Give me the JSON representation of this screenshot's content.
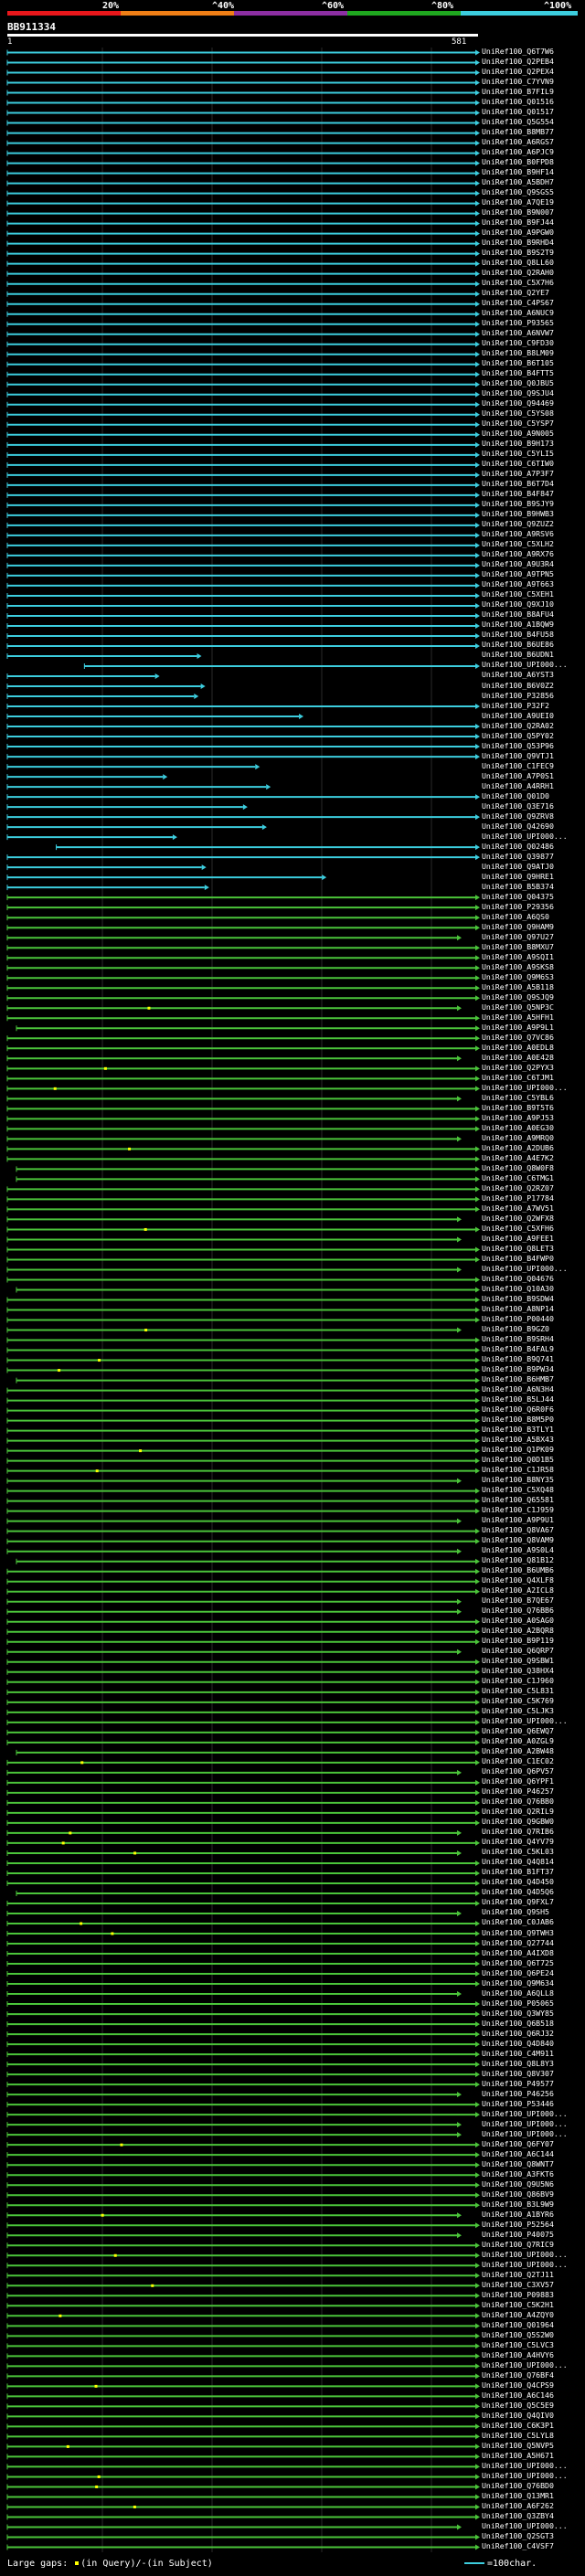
{
  "legend": {
    "percent_labels": [
      "20%",
      "^40%",
      "^60%",
      "^80%",
      "^100%"
    ],
    "colors": [
      "#e8171b",
      "#f07f16",
      "#8d2fa3",
      "#1fa71f",
      "#3ccdde"
    ]
  },
  "header": {
    "query_id": "BB911334",
    "scale_start": "1",
    "scale_end": "581"
  },
  "colors": {
    "cyan_hit": "#3ccdde",
    "green_hit": "#4bc43a",
    "background": "#000000",
    "grid": "#333333",
    "gap_marker": "#ffff00"
  },
  "hits": [
    "UniRef100_Q6T7W6",
    "UniRef100_Q2PEB4",
    "UniRef100_Q2PEX4",
    "UniRef100_C7YVN9",
    "UniRef100_B7FIL9",
    "UniRef100_Q01516",
    "UniRef100_Q01517",
    "UniRef100_Q5G554",
    "UniRef100_B8MB77",
    "UniRef100_A6RGS7",
    "UniRef100_A6PJC9",
    "UniRef100_B0FPD8",
    "UniRef100_B9HF14",
    "UniRef100_A5BDH7",
    "UniRef100_Q9SGS5",
    "UniRef100_A7QE19",
    "UniRef100_B9N007",
    "UniRef100_B9FJ44",
    "UniRef100_A9PGW0",
    "UniRef100_B9RHD4",
    "UniRef100_B9S2T9",
    "UniRef100_Q8LL60",
    "UniRef100_Q2RAH0",
    "UniRef100_C5X7H6",
    "UniRef100_Q2YE7",
    "UniRef100_C4PS67",
    "UniRef100_A6NUC9",
    "UniRef100_P93565",
    "UniRef100_A6NVW7",
    "UniRef100_C9FD30",
    "UniRef100_B8LM09",
    "UniRef100_B6T105",
    "UniRef100_B4FTT5",
    "UniRef100_Q0JBU5",
    "UniRef100_Q9SJU4",
    "UniRef100_Q94469",
    "UniRef100_C5YS08",
    "UniRef100_C5YSP7",
    "UniRef100_A9N005",
    "UniRef100_B9H173",
    "UniRef100_C5YLI5",
    "UniRef100_C6TIW0",
    "UniRef100_A7P3F7",
    "UniRef100_B6T7D4",
    "UniRef100_B4F847",
    "UniRef100_B9SJY9",
    "UniRef100_B9HWB3",
    "UniRef100_Q9ZUZ2",
    "UniRef100_A9RSV6",
    "UniRef100_C5XLH2",
    "UniRef100_A9RX76",
    "UniRef100_A9U3R4",
    "UniRef100_A9TPN5",
    "UniRef100_A9T663",
    "UniRef100_C5XEH1",
    "UniRef100_Q9XJ10",
    "UniRef100_B8AFU4",
    "UniRef100_A1BQW9",
    "UniRef100_B4FU58",
    "UniRef100_B6UE86",
    "UniRef100_B6UDN1",
    "UniRef100_UPI000...",
    "UniRef100_A6YST3",
    "UniRef100_B6V0Z2",
    "UniRef100_P32856",
    "UniRef100_P32F2",
    "UniRef100_A9UEI0",
    "UniRef100_Q2RA02",
    "UniRef100_Q5PY02",
    "UniRef100_Q53P96",
    "UniRef100_Q9VTJ1",
    "UniRef100_C1FEC9",
    "UniRef100_A7P0S1",
    "UniRef100_A4RRH1",
    "UniRef100_Q01D0",
    "UniRef100_Q3E716",
    "UniRef100_Q9ZRV8",
    "UniRef100_Q42690",
    "UniRef100_UPI000...",
    "UniRef100_Q02486",
    "UniRef100_Q39877",
    "UniRef100_Q9ATJ0",
    "UniRef100_Q9HRE1",
    "UniRef100_B5B374",
    "UniRef100_Q04375",
    "UniRef100_P29356",
    "UniRef100_A6QS0",
    "UniRef100_Q9HAM9",
    "UniRef100_Q97U27",
    "UniRef100_B8MXU7",
    "UniRef100_A9SQI1",
    "UniRef100_A9SKS8",
    "UniRef100_Q9M6S3",
    "UniRef100_A5B118",
    "UniRef100_Q9SJQ9",
    "UniRef100_Q5NP3C",
    "UniRef100_A5HFH1",
    "UniRef100_A9P9L1",
    "UniRef100_Q7VC86",
    "UniRef100_A0EDL8",
    "UniRef100_A0E428",
    "UniRef100_Q2PYX3",
    "UniRef100_C6TJM1",
    "UniRef100_UPI000...",
    "UniRef100_C5YBL6",
    "UniRef100_B9T5T6",
    "UniRef100_A9PJ53",
    "UniRef100_A0EG30",
    "UniRef100_A9MRQ0",
    "UniRef100_A2DUB6",
    "UniRef100_A4E7K2",
    "UniRef100_Q8W0F8",
    "UniRef100_C6TMG1",
    "UniRef100_Q2RZ07",
    "UniRef100_P17784",
    "UniRef100_A7WV51",
    "UniRef100_Q2WFX8",
    "UniRef100_C5XFH6",
    "UniRef100_A9FEE1",
    "UniRef100_Q8LET3",
    "UniRef100_B4FWP0",
    "UniRef100_UPI000...",
    "UniRef100_Q04676",
    "UniRef100_Q10A30",
    "UniRef100_B9SDW4",
    "UniRef100_A8NP14",
    "UniRef100_P00440",
    "UniRef100_B9GZ0",
    "UniRef100_B9SRH4",
    "UniRef100_B4FAL9",
    "UniRef100_B9Q741",
    "UniRef100_B9PW34",
    "UniRef100_B6HMB7",
    "UniRef100_A6N3H4",
    "UniRef100_B5LJ44",
    "UniRef100_Q6R0F6",
    "UniRef100_B8M5P0",
    "UniRef100_B3TLY1",
    "UniRef100_A5BX43",
    "UniRef100_Q1PK09",
    "UniRef100_Q0D1B5",
    "UniRef100_C1JR58",
    "UniRef100_B8NY35",
    "UniRef100_C5XQ48",
    "UniRef100_Q65581",
    "UniRef100_C1J959",
    "UniRef100_A9P9U1",
    "UniRef100_Q8VA67",
    "UniRef100_Q8VAM9",
    "UniRef100_A9S0L4",
    "UniRef100_Q81B12",
    "UniRef100_B6UMB6",
    "UniRef100_Q4XLF8",
    "UniRef100_A2ICL8",
    "UniRef100_B7QE67",
    "UniRef100_Q76BB6",
    "UniRef100_A0SAG0",
    "UniRef100_A2BQR8",
    "UniRef100_B9P119",
    "UniRef100_Q6QRP7",
    "UniRef100_Q9SBW1",
    "UniRef100_Q38HX4",
    "UniRef100_C1J960",
    "UniRef100_C5L831",
    "UniRef100_C5K769",
    "UniRef100_C5LJK3",
    "UniRef100_UPI000...",
    "UniRef100_Q6EWQ7",
    "UniRef100_A0ZGL9",
    "UniRef100_A2BW48",
    "UniRef100_C1EC02",
    "UniRef100_Q6PV57",
    "UniRef100_Q6YPF1",
    "UniRef100_P46257",
    "UniRef100_Q76BB0",
    "UniRef100_Q2RIL9",
    "UniRef100_Q9GBW0",
    "UniRef100_Q7RIB6",
    "UniRef100_Q4YV79",
    "UniRef100_C5KL03",
    "UniRef100_Q4Q814",
    "UniRef100_B1FT37",
    "UniRef100_Q4D450",
    "UniRef100_Q4D5Q6",
    "UniRef100_Q9FXL7",
    "UniRef100_Q9SH5",
    "UniRef100_C0JAB6",
    "UniRef100_Q9TWH3",
    "UniRef100_Q27744",
    "UniRef100_A4IXD8",
    "UniRef100_Q6T725",
    "UniRef100_Q6PE24",
    "UniRef100_Q9M634",
    "UniRef100_A6QLL8",
    "UniRef100_P05065",
    "UniRef100_Q3WY85",
    "UniRef100_Q6B518",
    "UniRef100_Q6RJ32",
    "UniRef100_Q4D840",
    "UniRef100_C4M911",
    "UniRef100_Q8L8Y3",
    "UniRef100_Q8V307",
    "UniRef100_P49577",
    "UniRef100_P46256",
    "UniRef100_P53446",
    "UniRef100_UPI000...",
    "UniRef100_UPI000...",
    "UniRef100_UPI000...",
    "UniRef100_Q6FY07",
    "UniRef100_A6C144",
    "UniRef100_Q8WNT7",
    "UniRef100_A3FKT6",
    "UniRef100_Q9U5N6",
    "UniRef100_Q86BV9",
    "UniRef100_B3L9W9",
    "UniRef100_A1BYR6",
    "UniRef100_P52564",
    "UniRef100_P40075",
    "UniRef100_Q7RIC9",
    "UniRef100_UPI000...",
    "UniRef100_UPI000...",
    "UniRef100_Q2TJ11",
    "UniRef100_C3XV57",
    "UniRef100_P09883",
    "UniRef100_C5K2H1",
    "UniRef100_A4ZQY0",
    "UniRef100_Q01964",
    "UniRef100_Q5S2W0",
    "UniRef100_C5LVC3",
    "UniRef100_A4HVY6",
    "UniRef100_UPI000...",
    "UniRef100_Q76BF4",
    "UniRef100_Q4CPS9",
    "UniRef100_A6C146",
    "UniRef100_Q5C5E9",
    "UniRef100_Q4QIV0",
    "UniRef100_C6K3P1",
    "UniRef100_C5LYL8",
    "UniRef100_Q5NVP5",
    "UniRef100_A5H671",
    "UniRef100_UPI000...",
    "UniRef100_UPI000...",
    "UniRef100_Q76BD0",
    "UniRef100_Q13MR1",
    "UniRef100_A6F262",
    "UniRef100_Q3ZBY4",
    "UniRef100_UPI000...",
    "UniRef100_Q2SGT3",
    "UniRef100_C4VSF7"
  ],
  "footer": {
    "large_gaps_label": "Large gaps:",
    "in_query_label": "(in Query)/",
    "in_subject_label": "(in Subject)",
    "scale_label": "=100char."
  }
}
